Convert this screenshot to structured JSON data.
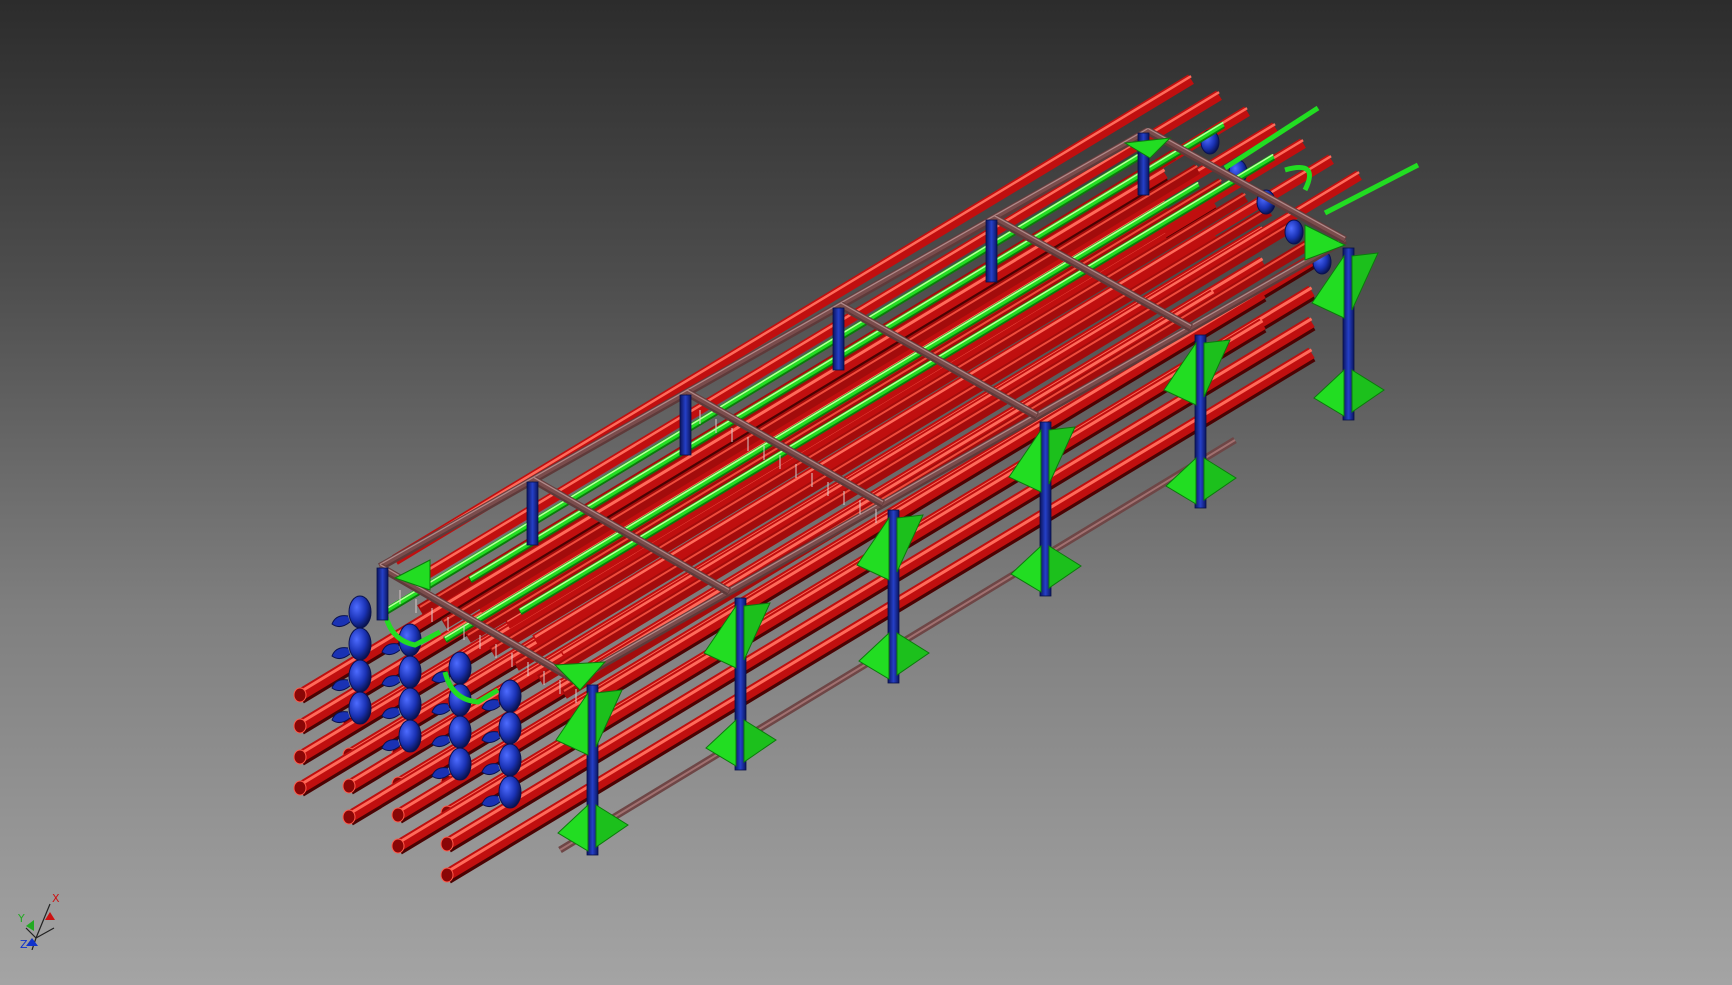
{
  "viewport": {
    "background_top": "#2c2c2c",
    "background_bottom": "#a4a4a4"
  },
  "model": {
    "colors": {
      "process_tube": "#c00f0f",
      "return_bend": "#1a32b4",
      "coil": "#22dd22",
      "support_column": "#1a32b4",
      "frame": "#7a4c4c",
      "gusset": "#22dd22"
    }
  },
  "view_triad": {
    "x_label": "X",
    "y_label": "Y",
    "z_label": "Z",
    "x_color": "#cc1111",
    "y_color": "#22aa22",
    "z_color": "#1133cc"
  }
}
